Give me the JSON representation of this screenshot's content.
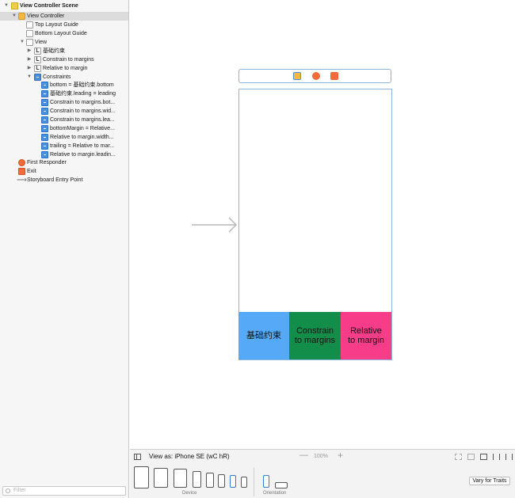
{
  "outline": {
    "items": [
      {
        "label": "View Controller Scene",
        "icon": "scene-icon"
      },
      {
        "label": "View Controller",
        "icon": "view-controller-icon"
      },
      {
        "label": "Top Layout Guide",
        "icon": "layout-guide-icon"
      },
      {
        "label": "Bottom Layout Guide",
        "icon": "layout-guide-icon"
      },
      {
        "label": "View",
        "icon": "view-icon"
      },
      {
        "label": "基础约束",
        "icon": "label-icon"
      },
      {
        "label": "Constrain to margins",
        "icon": "label-icon"
      },
      {
        "label": "Relative to margin",
        "icon": "label-icon"
      },
      {
        "label": "Constraints",
        "icon": "constraints-icon"
      },
      {
        "label": "bottom = 基础约束.bottom",
        "icon": "constraint-icon"
      },
      {
        "label": "基础约束.leading = leading",
        "icon": "constraint-icon"
      },
      {
        "label": "Constrain to margins.bot...",
        "icon": "constraint-icon"
      },
      {
        "label": "Constrain to margins.wid...",
        "icon": "constraint-icon"
      },
      {
        "label": "Constrain to margins.lea...",
        "icon": "constraint-icon"
      },
      {
        "label": "bottomMargin = Relative...",
        "icon": "constraint-icon"
      },
      {
        "label": "Relative to margin.width...",
        "icon": "constraint-icon"
      },
      {
        "label": "trailing = Relative to mar...",
        "icon": "constraint-icon"
      },
      {
        "label": "Relative to margin.leadin...",
        "icon": "constraint-icon"
      },
      {
        "label": "First Responder",
        "icon": "first-responder-icon"
      },
      {
        "label": "Exit",
        "icon": "exit-icon"
      },
      {
        "label": "Storyboard Entry Point",
        "icon": "entry-arrow-icon"
      }
    ],
    "label_glyph": "L",
    "entry_glyph": "⟶",
    "filter_placeholder": "Filter"
  },
  "canvas": {
    "labels": [
      "基础约束",
      "Constrain\nto margins",
      "Relative\nto margin"
    ],
    "label_colors": [
      "#55a9f6",
      "#138d4a",
      "#f73d8a"
    ]
  },
  "bottom_bar": {
    "view_as": "View as: iPhone SE (wC hR)",
    "zoom": "100%",
    "zoom_minus": "—",
    "zoom_plus": "+"
  },
  "device_bar": {
    "device_label": "Device",
    "orientation_label": "Orientation",
    "vary_button": "Vary for Traits"
  }
}
